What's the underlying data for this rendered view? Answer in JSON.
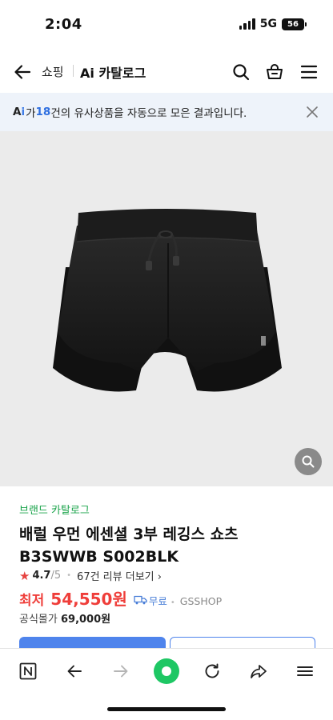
{
  "status": {
    "time": "2:04",
    "network": "5G",
    "battery": "56"
  },
  "header": {
    "breadcrumb_shop": "쇼핑",
    "title": "Ai 카탈로그"
  },
  "banner": {
    "prefix": "가 ",
    "count": "18",
    "suffix": "건의 유사상품을 자동으로 모은 결과입니다."
  },
  "product": {
    "brand": "브랜드 카탈로그",
    "name": "배럴 우먼 에센셜 3부 레깅스 쇼츠 B3SWWB S002BLK",
    "rating": "4.7",
    "rating_max": "/5",
    "review_link": "67건 리뷰 더보기",
    "price_label": "최저",
    "price": "54,550원",
    "shipping": "무료",
    "mall": "GSSHOP",
    "official_label": "공식몰가",
    "official_price": "69,000원"
  },
  "icons": {
    "back": "arrow-left-icon",
    "search": "search-icon",
    "cart": "shopping-bag-icon",
    "menu": "hamburger-icon",
    "close": "close-icon",
    "zoom": "zoom-icon",
    "star": "star-icon",
    "truck": "truck-icon",
    "naver": "naver-n-icon",
    "prev": "back-arrow-icon",
    "next": "forward-arrow-icon",
    "green": "green-dot-icon",
    "reload": "reload-icon",
    "share": "share-icon",
    "more": "menu-icon"
  },
  "colors": {
    "accent": "#4f84ec",
    "price": "#ef3e3a",
    "brand": "#19a34a",
    "banner_bg": "#eef3fa",
    "green_dot": "#1ec764"
  }
}
